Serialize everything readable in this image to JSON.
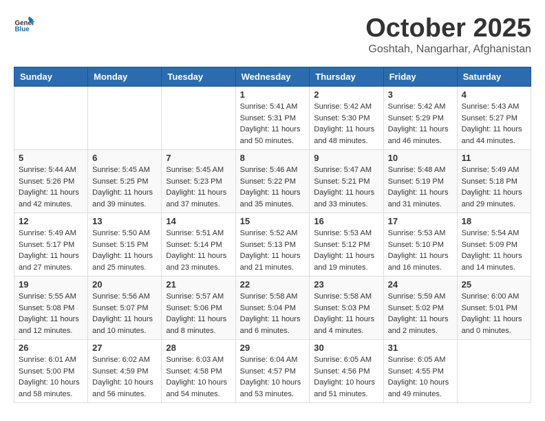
{
  "header": {
    "logo_general": "General",
    "logo_blue": "Blue",
    "month": "October 2025",
    "location": "Goshtah, Nangarhar, Afghanistan"
  },
  "weekdays": [
    "Sunday",
    "Monday",
    "Tuesday",
    "Wednesday",
    "Thursday",
    "Friday",
    "Saturday"
  ],
  "weeks": [
    [
      {
        "day": "",
        "info": ""
      },
      {
        "day": "",
        "info": ""
      },
      {
        "day": "",
        "info": ""
      },
      {
        "day": "1",
        "info": "Sunrise: 5:41 AM\nSunset: 5:31 PM\nDaylight: 11 hours\nand 50 minutes."
      },
      {
        "day": "2",
        "info": "Sunrise: 5:42 AM\nSunset: 5:30 PM\nDaylight: 11 hours\nand 48 minutes."
      },
      {
        "day": "3",
        "info": "Sunrise: 5:42 AM\nSunset: 5:29 PM\nDaylight: 11 hours\nand 46 minutes."
      },
      {
        "day": "4",
        "info": "Sunrise: 5:43 AM\nSunset: 5:27 PM\nDaylight: 11 hours\nand 44 minutes."
      }
    ],
    [
      {
        "day": "5",
        "info": "Sunrise: 5:44 AM\nSunset: 5:26 PM\nDaylight: 11 hours\nand 42 minutes."
      },
      {
        "day": "6",
        "info": "Sunrise: 5:45 AM\nSunset: 5:25 PM\nDaylight: 11 hours\nand 39 minutes."
      },
      {
        "day": "7",
        "info": "Sunrise: 5:45 AM\nSunset: 5:23 PM\nDaylight: 11 hours\nand 37 minutes."
      },
      {
        "day": "8",
        "info": "Sunrise: 5:46 AM\nSunset: 5:22 PM\nDaylight: 11 hours\nand 35 minutes."
      },
      {
        "day": "9",
        "info": "Sunrise: 5:47 AM\nSunset: 5:21 PM\nDaylight: 11 hours\nand 33 minutes."
      },
      {
        "day": "10",
        "info": "Sunrise: 5:48 AM\nSunset: 5:19 PM\nDaylight: 11 hours\nand 31 minutes."
      },
      {
        "day": "11",
        "info": "Sunrise: 5:49 AM\nSunset: 5:18 PM\nDaylight: 11 hours\nand 29 minutes."
      }
    ],
    [
      {
        "day": "12",
        "info": "Sunrise: 5:49 AM\nSunset: 5:17 PM\nDaylight: 11 hours\nand 27 minutes."
      },
      {
        "day": "13",
        "info": "Sunrise: 5:50 AM\nSunset: 5:15 PM\nDaylight: 11 hours\nand 25 minutes."
      },
      {
        "day": "14",
        "info": "Sunrise: 5:51 AM\nSunset: 5:14 PM\nDaylight: 11 hours\nand 23 minutes."
      },
      {
        "day": "15",
        "info": "Sunrise: 5:52 AM\nSunset: 5:13 PM\nDaylight: 11 hours\nand 21 minutes."
      },
      {
        "day": "16",
        "info": "Sunrise: 5:53 AM\nSunset: 5:12 PM\nDaylight: 11 hours\nand 19 minutes."
      },
      {
        "day": "17",
        "info": "Sunrise: 5:53 AM\nSunset: 5:10 PM\nDaylight: 11 hours\nand 16 minutes."
      },
      {
        "day": "18",
        "info": "Sunrise: 5:54 AM\nSunset: 5:09 PM\nDaylight: 11 hours\nand 14 minutes."
      }
    ],
    [
      {
        "day": "19",
        "info": "Sunrise: 5:55 AM\nSunset: 5:08 PM\nDaylight: 11 hours\nand 12 minutes."
      },
      {
        "day": "20",
        "info": "Sunrise: 5:56 AM\nSunset: 5:07 PM\nDaylight: 11 hours\nand 10 minutes."
      },
      {
        "day": "21",
        "info": "Sunrise: 5:57 AM\nSunset: 5:06 PM\nDaylight: 11 hours\nand 8 minutes."
      },
      {
        "day": "22",
        "info": "Sunrise: 5:58 AM\nSunset: 5:04 PM\nDaylight: 11 hours\nand 6 minutes."
      },
      {
        "day": "23",
        "info": "Sunrise: 5:58 AM\nSunset: 5:03 PM\nDaylight: 11 hours\nand 4 minutes."
      },
      {
        "day": "24",
        "info": "Sunrise: 5:59 AM\nSunset: 5:02 PM\nDaylight: 11 hours\nand 2 minutes."
      },
      {
        "day": "25",
        "info": "Sunrise: 6:00 AM\nSunset: 5:01 PM\nDaylight: 11 hours\nand 0 minutes."
      }
    ],
    [
      {
        "day": "26",
        "info": "Sunrise: 6:01 AM\nSunset: 5:00 PM\nDaylight: 10 hours\nand 58 minutes."
      },
      {
        "day": "27",
        "info": "Sunrise: 6:02 AM\nSunset: 4:59 PM\nDaylight: 10 hours\nand 56 minutes."
      },
      {
        "day": "28",
        "info": "Sunrise: 6:03 AM\nSunset: 4:58 PM\nDaylight: 10 hours\nand 54 minutes."
      },
      {
        "day": "29",
        "info": "Sunrise: 6:04 AM\nSunset: 4:57 PM\nDaylight: 10 hours\nand 53 minutes."
      },
      {
        "day": "30",
        "info": "Sunrise: 6:05 AM\nSunset: 4:56 PM\nDaylight: 10 hours\nand 51 minutes."
      },
      {
        "day": "31",
        "info": "Sunrise: 6:05 AM\nSunset: 4:55 PM\nDaylight: 10 hours\nand 49 minutes."
      },
      {
        "day": "",
        "info": ""
      }
    ]
  ]
}
